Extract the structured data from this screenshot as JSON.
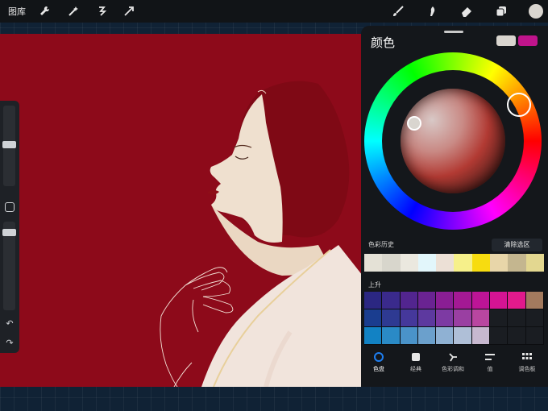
{
  "toolbar": {
    "gallery_label": "图库",
    "left_icons": [
      "wrench-icon",
      "magic-wand-icon",
      "selection-icon",
      "transform-arrow-icon"
    ],
    "right_icons": [
      "brush-icon",
      "smudge-icon",
      "eraser-icon",
      "layers-icon",
      "color-icon"
    ]
  },
  "panel": {
    "title": "颜色",
    "primary_color": "#d9d5cf",
    "secondary_color": "#c0148c",
    "history": {
      "label": "色彩历史",
      "clear_label": "清除选区",
      "swatches": [
        "#e4e1d6",
        "#d8d6cc",
        "#ebe8df",
        "#e2f6fb",
        "#ece0d6",
        "#f6f08a",
        "#f7dc10",
        "#e8d6a9",
        "#c4b68f",
        "#e3d790"
      ]
    },
    "palette": {
      "label": "上升",
      "rows": [
        [
          "#2b2782",
          "#3a2a8c",
          "#52258f",
          "#6a2392",
          "#8a1e94",
          "#a41994",
          "#bd1496",
          "#d51493",
          "#e21a8c",
          "#a37a5e"
        ],
        [
          "#1a3d8f",
          "#2e3a92",
          "#45389b",
          "#5d399f",
          "#7d3aa3",
          "#9a3fa2",
          "#b946a0",
          "#1a1d22",
          "#1a1d22",
          "#1a1d22"
        ],
        [
          "#1282c4",
          "#2a8ac6",
          "#4a93c9",
          "#6ba0cc",
          "#8fb1d3",
          "#afbfd7",
          "#c7b8cf",
          "#1a1d22",
          "#1a1d22",
          "#1a1d22"
        ]
      ]
    },
    "tabs": [
      {
        "label": "色盘",
        "icon": "disc-icon",
        "active": true
      },
      {
        "label": "经典",
        "icon": "square-icon",
        "active": false
      },
      {
        "label": "色彩调和",
        "icon": "harmony-icon",
        "active": false
      },
      {
        "label": "值",
        "icon": "sliders-icon",
        "active": false
      },
      {
        "label": "调色板",
        "icon": "grid-icon",
        "active": false
      }
    ]
  },
  "canvas": {
    "background_color": "#8d0a1a"
  }
}
